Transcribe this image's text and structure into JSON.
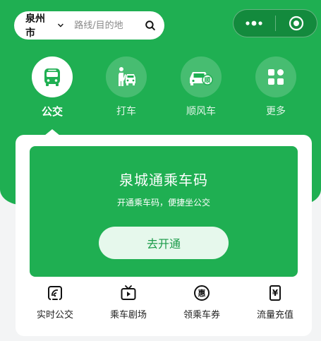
{
  "header": {
    "city": "泉州市",
    "search_placeholder": "路线/目的地"
  },
  "nav": {
    "items": [
      {
        "label": "公交",
        "icon": "bus-icon",
        "active": true
      },
      {
        "label": "打车",
        "icon": "hail-taxi-icon",
        "active": false
      },
      {
        "label": "顺风车",
        "icon": "carpool-car-icon",
        "active": false
      },
      {
        "label": "更多",
        "icon": "grid-icon",
        "active": false
      }
    ]
  },
  "card": {
    "title": "泉城通乘车码",
    "subtitle": "开通乘车码，便捷坐公交",
    "button_label": "去开通",
    "badge_text": "顺"
  },
  "tools": {
    "items": [
      {
        "label": "实时公交",
        "icon": "realtime-bus-icon"
      },
      {
        "label": "乘车剧场",
        "icon": "tv-play-icon"
      },
      {
        "label": "领乘车券",
        "icon": "coupon-hui-icon",
        "glyph": "惠"
      },
      {
        "label": "流量充值",
        "icon": "yuan-recharge-icon",
        "glyph": "¥"
      }
    ]
  },
  "colors": {
    "primary_green": "#1faf52",
    "capsule_green": "#138a3d",
    "button_bg": "#e6f8ec",
    "button_text": "#1a9a48"
  }
}
